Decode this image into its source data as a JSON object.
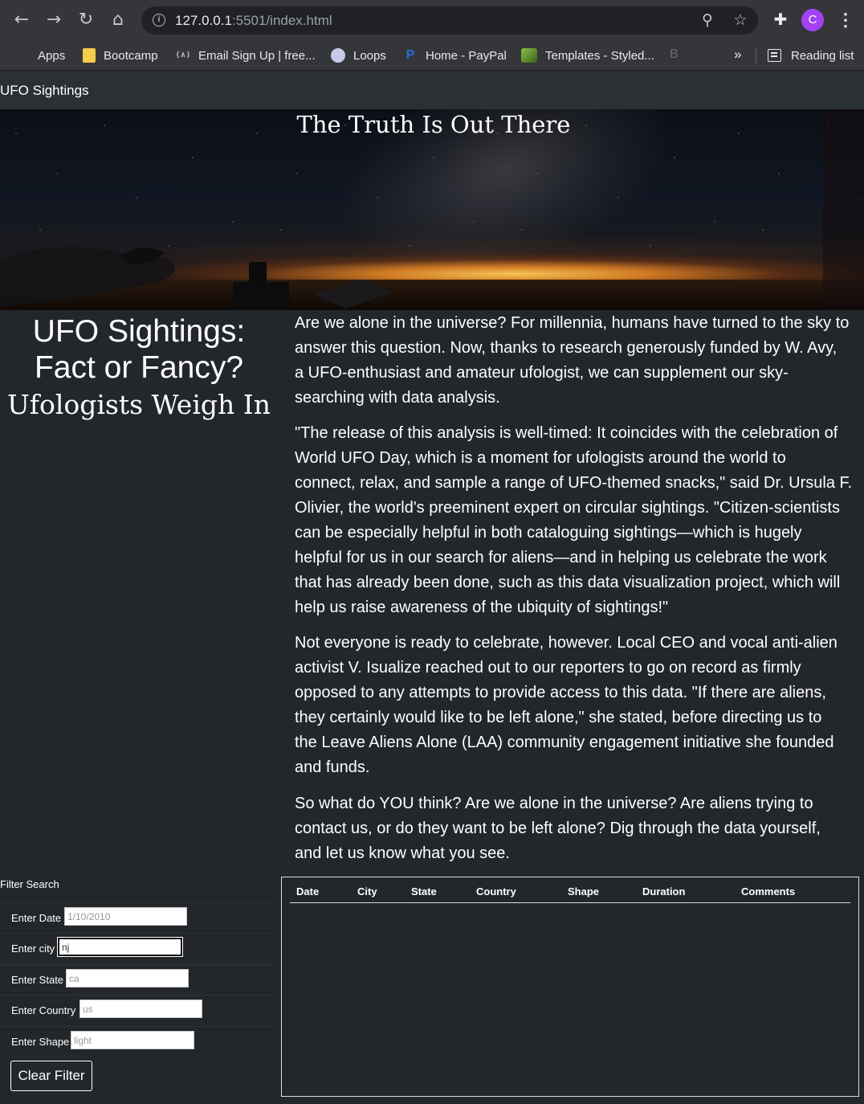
{
  "browser": {
    "url_host": "127.0.0.1",
    "url_path": ":5501/index.html",
    "profile_initial": "C",
    "bookmarks": [
      "Apps",
      "Bootcamp",
      "Email Sign Up | free...",
      "Loops",
      "Home - PayPal",
      "Templates - Styled..."
    ],
    "bookmark_faded": "B",
    "overflow": "»",
    "reading_list": "Reading list"
  },
  "navbar": {
    "brand": "UFO Sightings"
  },
  "hero": {
    "title": "The Truth Is Out There"
  },
  "heading": {
    "line1": "UFO Sightings:",
    "line2": "Fact or Fancy?",
    "subtitle": "Ufologists Weigh In"
  },
  "article": {
    "p1": [
      "Are we alone in the universe? For millennia, humans have turned to the sky to",
      "answer this question. Now, thanks to research generously funded by W. Avy,",
      "a UFO-enthusiast and amateur ufologist, we can supplement our sky-",
      "searching with data analysis."
    ],
    "p2": [
      "\"The release of this analysis is well-timed: It coincides with the celebration of",
      "World UFO Day, which is a moment for ufologists around the world to",
      "connect, relax, and sample a range of UFO-themed snacks,\" said Dr. Ursula F.",
      "Olivier, the world's preeminent expert on circular sightings. \"Citizen-scientists",
      "can be especially helpful in both cataloguing sightings—which is hugely",
      "helpful for us in our search for aliens—and in helping us celebrate the work",
      "that has already been done, such as this data visualization project, which will",
      "help us raise awareness of the ubiquity of sightings!\""
    ],
    "p3": [
      "Not everyone is ready to celebrate, however. Local CEO and vocal anti-alien",
      "activist V. Isualize reached out to our reporters to go on record as firmly",
      "opposed to any attempts to provide access to this data. \"If there are aliens,",
      "they certainly would like to be left alone,\" she stated, before directing us to",
      "the Leave Aliens Alone (LAA) community engagement initiative she founded",
      "and funds."
    ],
    "p4": [
      "So what do YOU think? Are we alone in the universe? Are aliens trying to",
      "contact us, or do they want to be left alone? Dig through the data yourself,",
      "and let us know what you see."
    ]
  },
  "filters": {
    "title": "Filter Search",
    "fields": [
      {
        "label": "Enter Date",
        "placeholder": "1/10/2010",
        "value": ""
      },
      {
        "label": "Enter city",
        "placeholder": "",
        "value": "nj"
      },
      {
        "label": "Enter State",
        "placeholder": "ca",
        "value": ""
      },
      {
        "label": "Enter Country",
        "placeholder": "us",
        "value": ""
      },
      {
        "label": "Enter Shape",
        "placeholder": "light",
        "value": ""
      }
    ],
    "clear_label": "Clear Filter"
  },
  "table": {
    "columns": [
      "Date",
      "City",
      "State",
      "Country",
      "Shape",
      "Duration",
      "Comments"
    ],
    "rows": []
  },
  "colors": {
    "page_bg": "#23272b",
    "navbar_bg": "#2b3035",
    "profile": "#a142f4"
  }
}
